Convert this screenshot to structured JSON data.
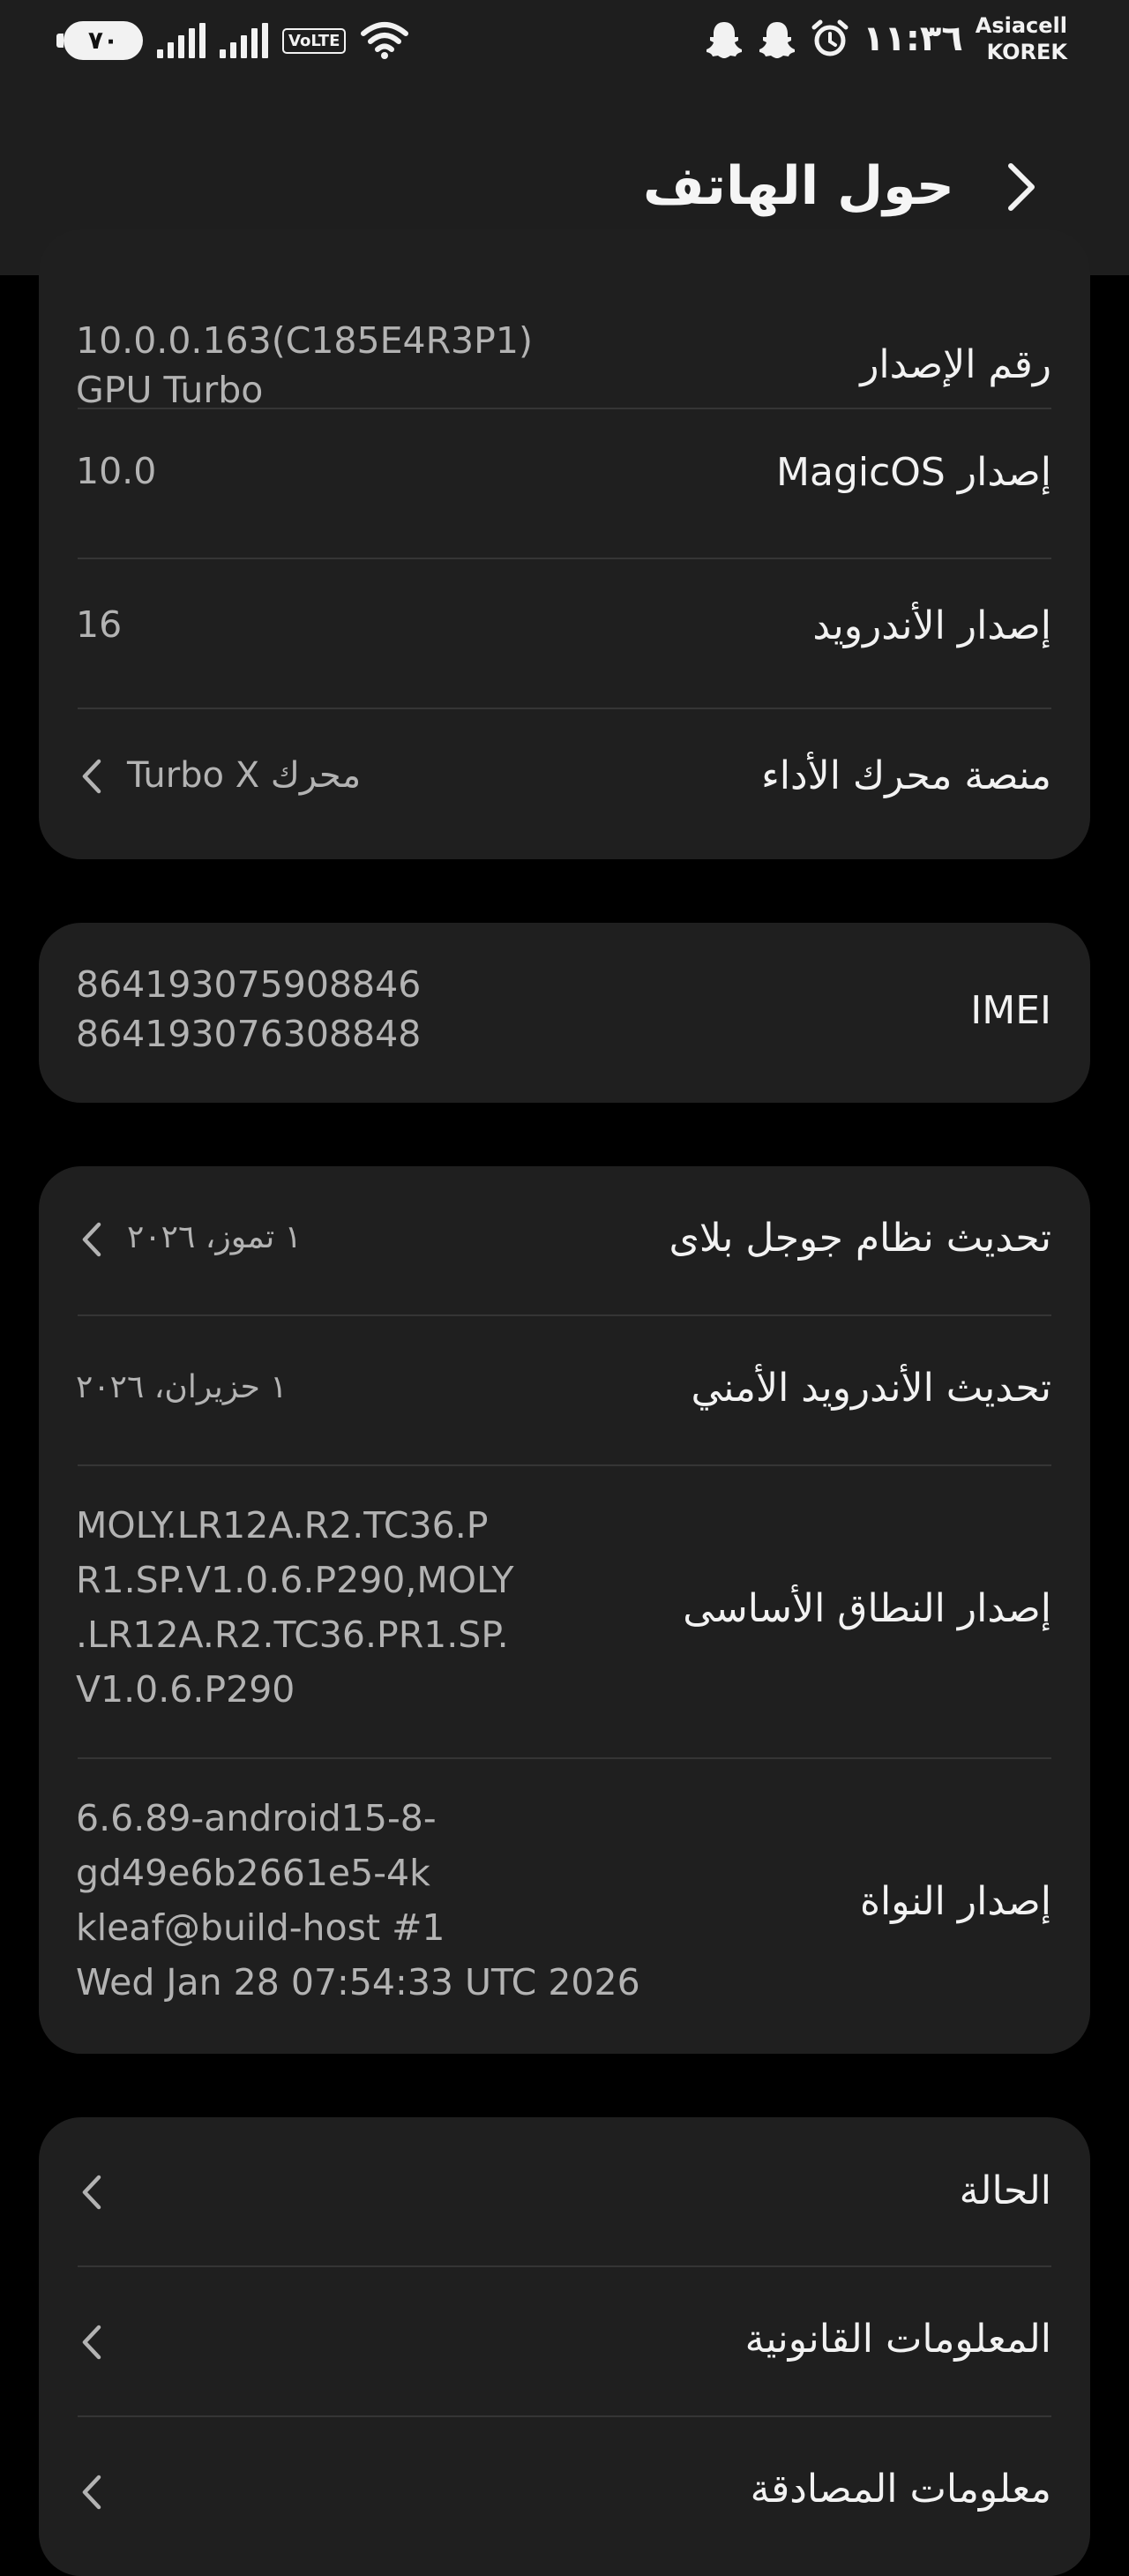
{
  "status_bar": {
    "battery": "٧٠",
    "volte": "VoLTE",
    "time": "١١:٣٦",
    "carrier_1": "Asiacell",
    "carrier_2": "KOREK",
    "icons": [
      "battery-icon",
      "signal-icon",
      "signal-icon",
      "volte-icon",
      "wifi-icon",
      "snapchat-icon",
      "snapchat-icon",
      "alarm-icon"
    ]
  },
  "header": {
    "title": "حول الهاتف",
    "back_icon": "chevron-right-icon"
  },
  "card_software": {
    "build": {
      "label": "رقم الإصدار",
      "value_line1": "10.0.0.163(C185E4R3P1)",
      "value_line2": "GPU Turbo"
    },
    "magicos": {
      "label": "إصدار MagicOS",
      "value": "10.0"
    },
    "android": {
      "label": "إصدار الأندرويد",
      "value": "16"
    },
    "engine": {
      "label": "منصة محرك الأداء",
      "value": "محرك Turbo X"
    }
  },
  "card_imei": {
    "label": "IMEI",
    "value_line1": "864193075908846",
    "value_line2": "864193076308848"
  },
  "card_updates": {
    "google_play": {
      "label": "تحديث نظام جوجل بلاى",
      "value": "١ تموز، ٢٠٢٦"
    },
    "security": {
      "label": "تحديث الأندرويد الأمني",
      "value": "١ حزيران، ٢٠٢٦"
    },
    "baseband": {
      "label": "إصدار النطاق الأساسى",
      "value_lines": [
        "MOLY.LR12A.R2.TC36.P",
        "R1.SP.V1.0.6.P290,MOLY",
        ".LR12A.R2.TC36.PR1.SP.",
        "V1.0.6.P290"
      ]
    },
    "kernel": {
      "label": "إصدار النواة",
      "value_lines": [
        "6.6.89-android15-8-",
        "gd49e6b2661e5-4k",
        "kleaf@build-host #1",
        "Wed Jan 28 07:54:33 UTC 2026"
      ]
    }
  },
  "card_more": {
    "items": [
      {
        "label": "الحالة"
      },
      {
        "label": "المعلومات القانونية"
      },
      {
        "label": "معلومات المصادقة"
      }
    ]
  },
  "colors": {
    "background": "#000000",
    "card": "#1f1f1f",
    "header": "#1e1e1e",
    "primary_text": "#f2f2f2",
    "secondary_text": "#b3b3b3",
    "divider": "#353535"
  }
}
